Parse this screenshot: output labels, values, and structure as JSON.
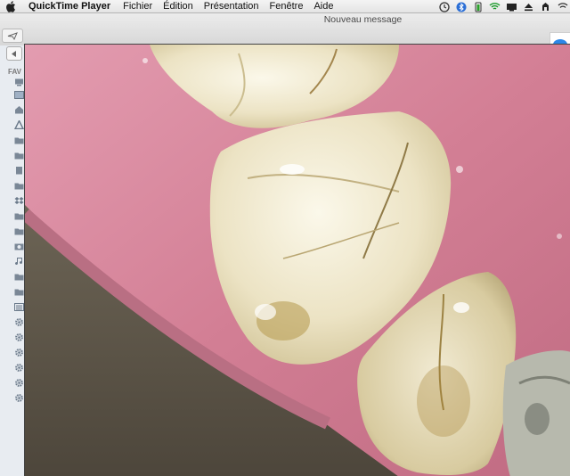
{
  "menubar": {
    "app_name": "QuickTime Player",
    "items": [
      "Fichier",
      "Édition",
      "Présentation",
      "Fenêtre",
      "Aide"
    ],
    "status_icons": [
      "time-machine-icon",
      "bluetooth-icon",
      "battery-icon",
      "wifi-icon",
      "display-icon",
      "eject-icon",
      "scripts-icon",
      "airplay-icon"
    ]
  },
  "mail_window": {
    "title": "Nouveau message"
  },
  "finder_sidebar": {
    "section_label": "FAV",
    "icons": [
      "computer-icon",
      "desktop-icon",
      "home-icon",
      "applications-icon",
      "folder-icon",
      "folder-icon",
      "documents-icon",
      "folder-icon",
      "dropbox-icon",
      "folder-icon",
      "folder-icon",
      "photos-icon",
      "music-icon",
      "folder-icon",
      "folder-icon",
      "list-icon",
      "gear-icon",
      "gear-icon",
      "gear-icon",
      "gear-icon",
      "gear-icon",
      "gear-icon"
    ]
  },
  "video": {
    "subject": "intraoral camera view of teeth and gum"
  },
  "colors": {
    "gum": "#d5879b",
    "tooth": "#efe8cf",
    "stain": "#a8873a",
    "menubar": "#ececec"
  }
}
